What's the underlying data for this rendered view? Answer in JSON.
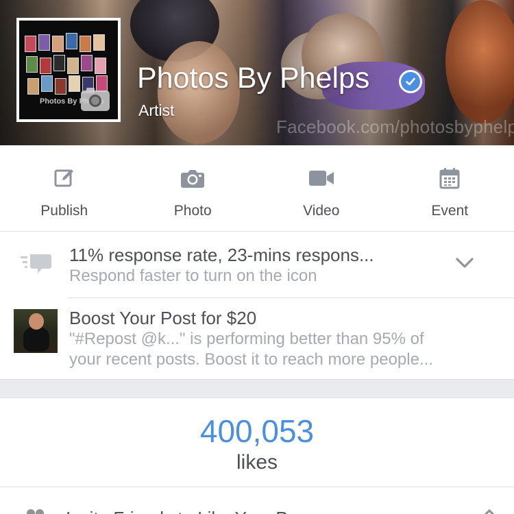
{
  "cover": {
    "watermark": "Facebook.com/photosbyphelps"
  },
  "profile": {
    "picture_caption": "Photos By Phelps",
    "name": "Photos By Phelps",
    "category": "Artist",
    "verified": true,
    "icons": {
      "camera": "camera-icon",
      "verified": "verified-badge-icon"
    }
  },
  "actions": [
    {
      "label": "Publish",
      "icon": "compose-icon"
    },
    {
      "label": "Photo",
      "icon": "camera-icon"
    },
    {
      "label": "Video",
      "icon": "video-camera-icon"
    },
    {
      "label": "Event",
      "icon": "calendar-icon"
    }
  ],
  "response": {
    "title": "11% response rate, 23-mins respons...",
    "subtitle": "Respond faster to turn on the icon",
    "icon": "speech-bubble-icon"
  },
  "boost": {
    "title": "Boost Your Post for $20",
    "body_line1": "\"#Repost @k...\" is performing better than 95% of",
    "body_line2": "your recent posts. Boost it to reach more people..."
  },
  "likes": {
    "count": "400,053",
    "label": "likes"
  },
  "invite": {
    "text": "Invite Friends to Like Your Page",
    "icon": "people-icon"
  },
  "colors": {
    "accent": "#4a90e2",
    "icon_gray": "#8d949e",
    "text_dark": "#4b4f56",
    "text_muted": "#a5a9b0",
    "separator": "#e9ebee"
  }
}
